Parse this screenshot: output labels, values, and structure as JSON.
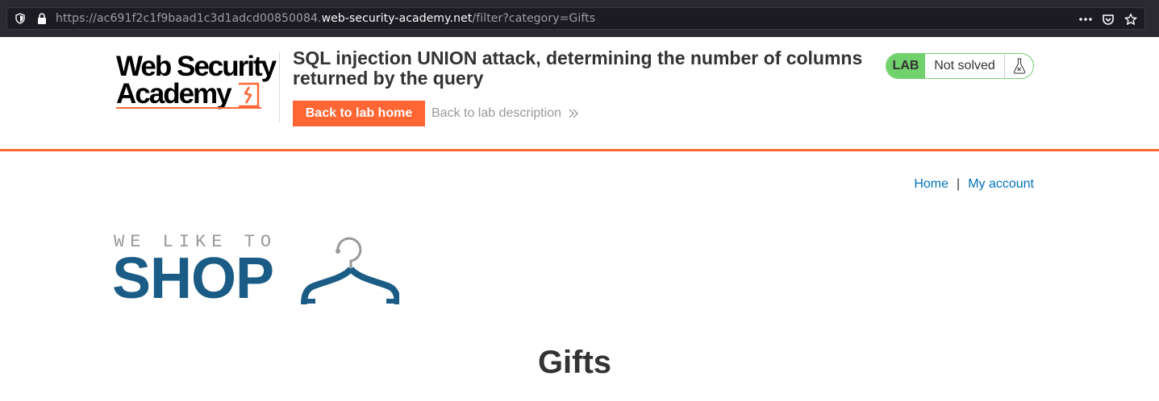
{
  "browser": {
    "url_prefix": "https://ac691f2c1f9baad1c3d1adcd00850084.",
    "url_domain": "web-security-academy.net",
    "url_path": "/filter?category=Gifts"
  },
  "lab_header": {
    "logo_line1": "Web Security",
    "logo_line2": "Academy",
    "title": "SQL injection UNION attack, determining the number of columns returned by the query",
    "back_home_label": "Back to lab home",
    "back_description_label": "Back to lab description",
    "status_badge": "LAB",
    "status_text": "Not solved"
  },
  "nav": {
    "home": "Home",
    "separator": "|",
    "my_account": "My account"
  },
  "shop_logo": {
    "small_text": "WE LIKE TO",
    "big_text": "SHOP"
  },
  "page": {
    "heading": "Gifts"
  },
  "colors": {
    "accent_orange": "#ff6633",
    "lab_green": "#70d16d",
    "link_blue": "#0071bc",
    "shop_blue": "#1a5c85"
  }
}
